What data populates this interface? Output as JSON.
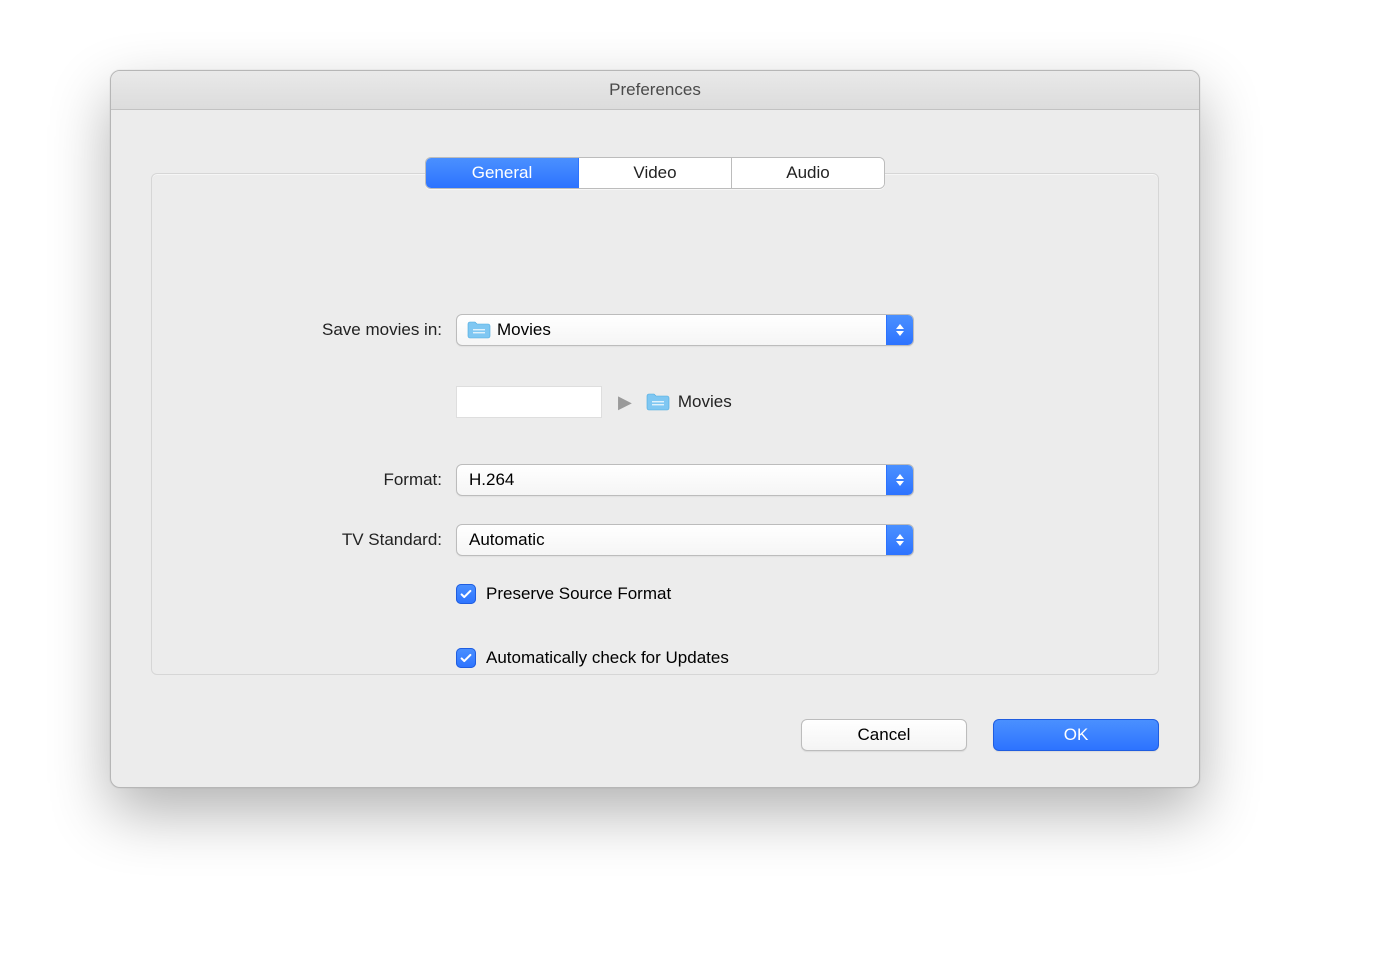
{
  "window": {
    "title": "Preferences"
  },
  "tabs": {
    "general": "General",
    "video": "Video",
    "audio": "Audio"
  },
  "labels": {
    "save_in": "Save movies in:",
    "format": "Format:",
    "tv_standard": "TV Standard:"
  },
  "values": {
    "save_folder": "Movies",
    "breadcrumb_folder": "Movies",
    "format": "H.264",
    "tv_standard": "Automatic"
  },
  "checks": {
    "preserve_source": "Preserve Source Format",
    "auto_update": "Automatically check for Updates"
  },
  "buttons": {
    "cancel": "Cancel",
    "ok": "OK"
  }
}
